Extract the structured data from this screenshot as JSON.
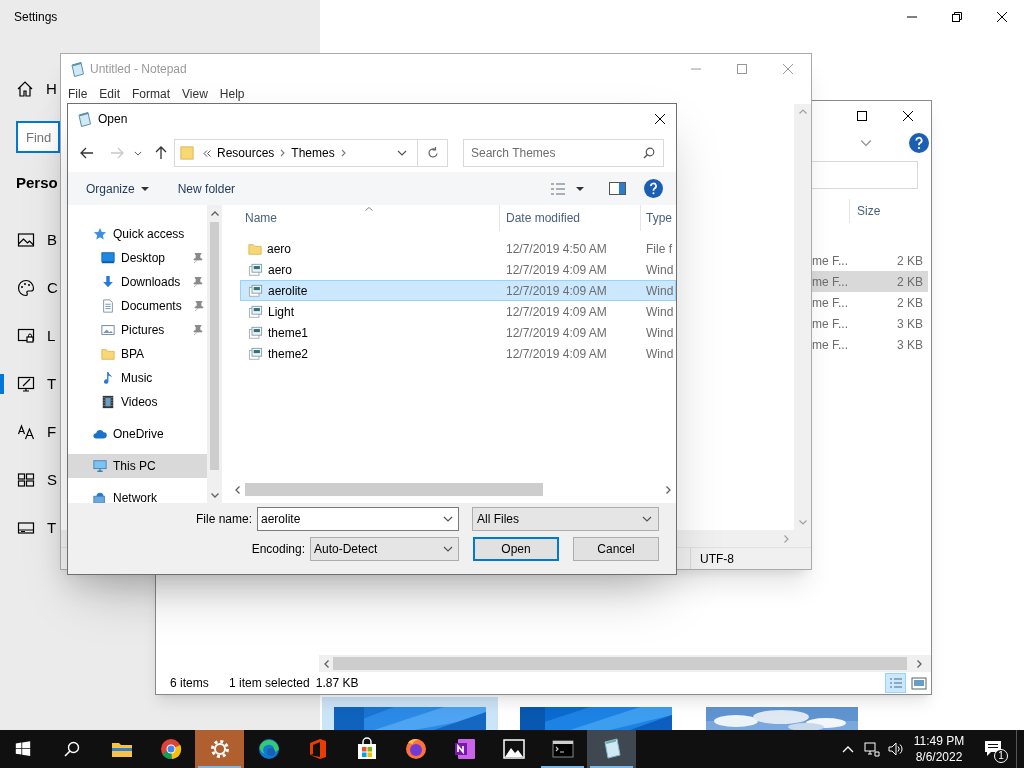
{
  "settings": {
    "title": "Settings",
    "home": {
      "label": "H"
    },
    "search": {
      "placeholder": "Find"
    },
    "section": "Perso",
    "nav": [
      {
        "kind": "background",
        "label": "B",
        "selected": false
      },
      {
        "kind": "colors",
        "label": "C",
        "selected": false
      },
      {
        "kind": "lock",
        "label": "L",
        "selected": false
      },
      {
        "kind": "themes",
        "label": "T",
        "selected": true
      },
      {
        "kind": "fonts",
        "label": "F",
        "selected": false
      },
      {
        "kind": "start",
        "label": "S",
        "selected": false
      },
      {
        "kind": "taskbar",
        "label": "T",
        "selected": false
      }
    ],
    "themes": [
      {
        "kind": "picture",
        "selected": true
      },
      {
        "kind": "picture",
        "selected": false
      },
      {
        "kind": "picture",
        "selected": false
      }
    ]
  },
  "explorer": {
    "column": "Size",
    "rows": [
      {
        "type": "me F...",
        "size": "2 KB",
        "selected": false
      },
      {
        "type": "me F...",
        "size": "2 KB",
        "selected": true
      },
      {
        "type": "me F...",
        "size": "2 KB",
        "selected": false
      },
      {
        "type": "me F...",
        "size": "3 KB",
        "selected": false
      },
      {
        "type": "me F...",
        "size": "3 KB",
        "selected": false
      }
    ],
    "status": {
      "items": "6 items",
      "selection": "1 item selected",
      "size": "1.87 KB"
    },
    "views": [
      {
        "kind": "details",
        "selected": true
      },
      {
        "kind": "large_icons",
        "selected": false
      }
    ]
  },
  "notepad": {
    "title": "Untitled - Notepad",
    "menu": [
      "File",
      "Edit",
      "Format",
      "View",
      "Help"
    ],
    "encoding": "UTF-8"
  },
  "open_dialog": {
    "title": "Open",
    "path": [
      "Resources",
      "Themes"
    ],
    "search": {
      "placeholder": "Search Themes"
    },
    "organize": "Organize",
    "new_folder": "New folder",
    "nav": [
      {
        "kind": "quick_access",
        "label": "Quick access",
        "selected": false,
        "children": [
          {
            "kind": "desktop",
            "label": "Desktop",
            "pinned": true,
            "selected": false
          },
          {
            "kind": "downloads",
            "label": "Downloads",
            "pinned": true,
            "selected": false
          },
          {
            "kind": "documents",
            "label": "Documents",
            "pinned": true,
            "selected": false
          },
          {
            "kind": "pictures",
            "label": "Pictures",
            "pinned": true,
            "selected": false
          },
          {
            "kind": "folder",
            "label": "BPA",
            "pinned": false,
            "selected": false
          },
          {
            "kind": "music",
            "label": "Music",
            "pinned": false,
            "selected": false
          },
          {
            "kind": "videos",
            "label": "Videos",
            "pinned": false,
            "selected": false
          }
        ]
      },
      {
        "kind": "onedrive",
        "label": "OneDrive",
        "selected": false
      },
      {
        "kind": "pc",
        "label": "This PC",
        "selected": true
      },
      {
        "kind": "network",
        "label": "Network",
        "selected": false
      }
    ],
    "columns": [
      "Name",
      "Date modified",
      "Type"
    ],
    "files": [
      {
        "kind": "folder",
        "name": "aero",
        "date": "12/7/2019 4:50 AM",
        "type": "File f",
        "selected": false
      },
      {
        "kind": "theme",
        "name": "aero",
        "date": "12/7/2019 4:09 AM",
        "type": "Wind",
        "selected": false
      },
      {
        "kind": "theme",
        "name": "aerolite",
        "date": "12/7/2019 4:09 AM",
        "type": "Wind",
        "selected": true
      },
      {
        "kind": "theme",
        "name": "Light",
        "date": "12/7/2019 4:09 AM",
        "type": "Wind",
        "selected": false
      },
      {
        "kind": "theme",
        "name": "theme1",
        "date": "12/7/2019 4:09 AM",
        "type": "Wind",
        "selected": false
      },
      {
        "kind": "theme",
        "name": "theme2",
        "date": "12/7/2019 4:09 AM",
        "type": "Wind",
        "selected": false
      }
    ],
    "file_name": {
      "label": "File name:",
      "value": "aerolite"
    },
    "file_type": "All Files",
    "encoding": {
      "label": "Encoding:",
      "value": "Auto-Detect"
    },
    "buttons": [
      {
        "label": "Open",
        "default": true
      },
      {
        "label": "Cancel",
        "default": false
      }
    ]
  },
  "taskbar": {
    "apps": [
      {
        "kind": "explorer",
        "running": false,
        "active": false
      },
      {
        "kind": "chrome",
        "running": false,
        "active": false
      },
      {
        "kind": "settings",
        "running": true,
        "active": false
      },
      {
        "kind": "edge",
        "running": false,
        "active": false
      },
      {
        "kind": "office",
        "running": false,
        "active": false
      },
      {
        "kind": "store",
        "running": false,
        "active": false
      },
      {
        "kind": "firefox",
        "running": false,
        "active": false
      },
      {
        "kind": "onenote",
        "running": false,
        "active": false
      },
      {
        "kind": "photos",
        "running": false,
        "active": false
      },
      {
        "kind": "terminal",
        "running": true,
        "active": false
      },
      {
        "kind": "notepad",
        "running": true,
        "active": true
      }
    ],
    "time": "11:49 PM",
    "date": "8/6/2022",
    "notifications": "1"
  }
}
